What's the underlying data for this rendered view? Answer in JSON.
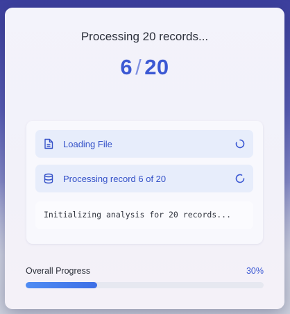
{
  "dialog": {
    "title": "Processing 20 records...",
    "counter": {
      "current": "6",
      "separator": "/",
      "total": "20"
    }
  },
  "steps": [
    {
      "label": "Loading File",
      "icon": "file-icon",
      "status_icon": "spinner-icon"
    },
    {
      "label": "Processing record 6 of 20",
      "icon": "database-icon",
      "status_icon": "spinner-icon"
    }
  ],
  "log": {
    "text": "Initializing analysis for 20 records..."
  },
  "progress": {
    "label": "Overall Progress",
    "percent_text": "30%",
    "value": 0.3
  },
  "colors": {
    "accent": "#3b58d3",
    "step_bg": "#e7edfb",
    "bar": "#4f8cf3"
  }
}
